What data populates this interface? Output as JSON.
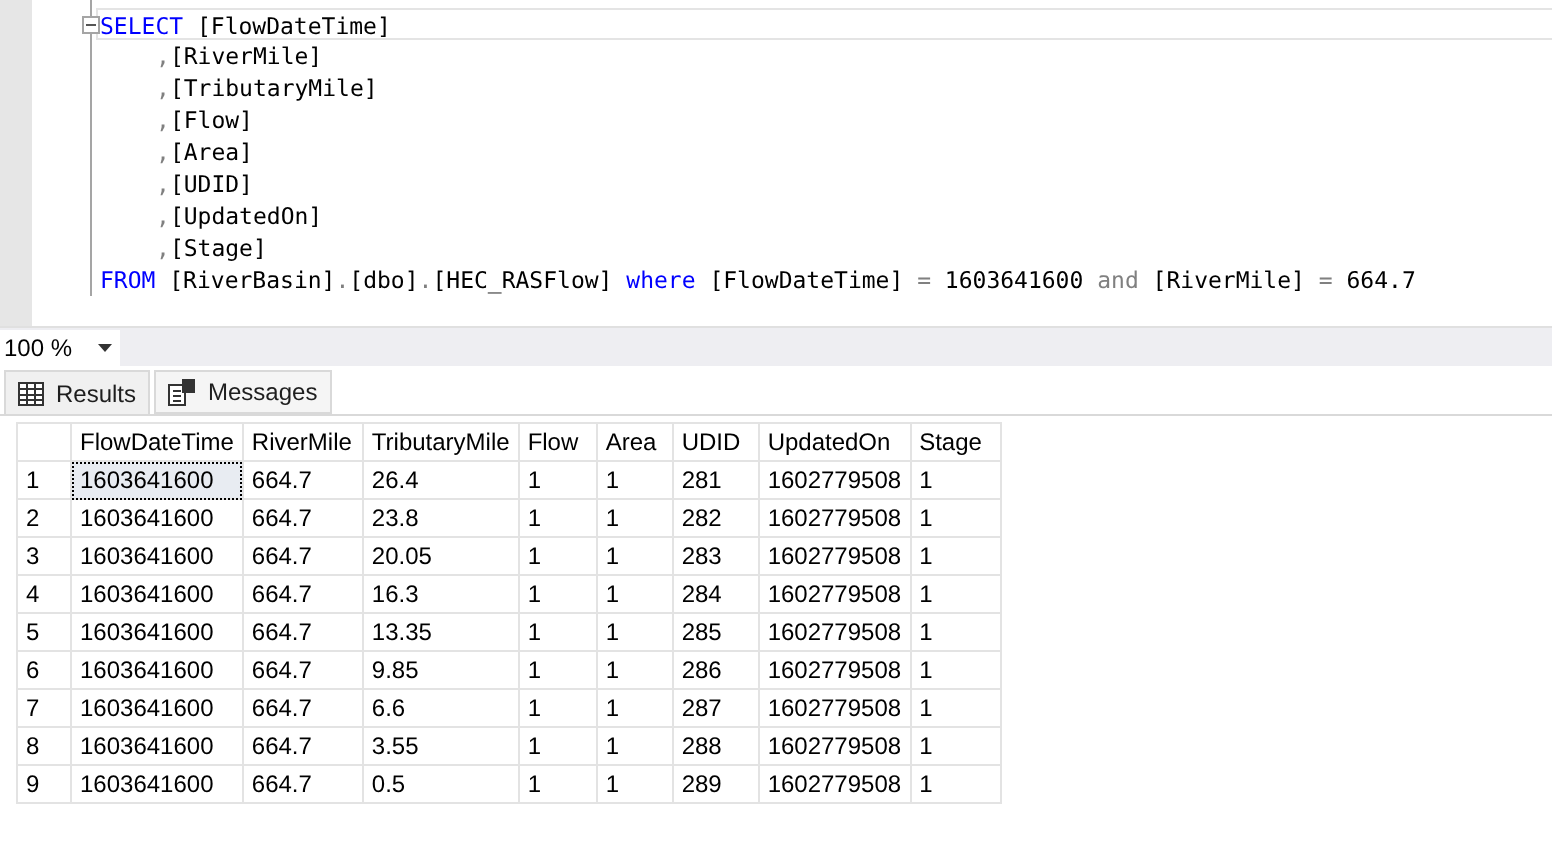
{
  "editor": {
    "lines": [
      {
        "tokens": [
          {
            "kind": "kw",
            "text": "SELECT"
          },
          {
            "kind": "ident",
            "text": " [FlowDateTime]"
          }
        ]
      },
      {
        "tokens": [
          {
            "kind": "op",
            "text": ","
          },
          {
            "kind": "ident",
            "text": "[RiverMile]"
          }
        ]
      },
      {
        "tokens": [
          {
            "kind": "op",
            "text": ","
          },
          {
            "kind": "ident",
            "text": "[TributaryMile]"
          }
        ]
      },
      {
        "tokens": [
          {
            "kind": "op",
            "text": ","
          },
          {
            "kind": "ident",
            "text": "[Flow]"
          }
        ]
      },
      {
        "tokens": [
          {
            "kind": "op",
            "text": ","
          },
          {
            "kind": "ident",
            "text": "[Area]"
          }
        ]
      },
      {
        "tokens": [
          {
            "kind": "op",
            "text": ","
          },
          {
            "kind": "ident",
            "text": "[UDID]"
          }
        ]
      },
      {
        "tokens": [
          {
            "kind": "op",
            "text": ","
          },
          {
            "kind": "ident",
            "text": "[UpdatedOn]"
          }
        ]
      },
      {
        "tokens": [
          {
            "kind": "op",
            "text": ","
          },
          {
            "kind": "ident",
            "text": "[Stage]"
          }
        ]
      },
      {
        "tokens": [
          {
            "kind": "kw",
            "text": "FROM"
          },
          {
            "kind": "ident",
            "text": " [RiverBasin]"
          },
          {
            "kind": "op",
            "text": "."
          },
          {
            "kind": "ident",
            "text": "[dbo]"
          },
          {
            "kind": "op",
            "text": "."
          },
          {
            "kind": "ident",
            "text": "[HEC_RASFlow] "
          },
          {
            "kind": "kw",
            "text": "where"
          },
          {
            "kind": "ident",
            "text": " [FlowDateTime] "
          },
          {
            "kind": "op",
            "text": "="
          },
          {
            "kind": "ident",
            "text": " 1603641600 "
          },
          {
            "kind": "op",
            "text": "and"
          },
          {
            "kind": "ident",
            "text": " [RiverMile] "
          },
          {
            "kind": "op",
            "text": "="
          },
          {
            "kind": "ident",
            "text": " 664.7"
          }
        ]
      }
    ]
  },
  "zoom": {
    "value": "100 %"
  },
  "tabs": [
    {
      "label": "Results",
      "kind": "grid",
      "selected": true
    },
    {
      "label": "Messages",
      "kind": "messages",
      "selected": false
    }
  ],
  "table": {
    "columns": [
      "FlowDateTime",
      "RiverMile",
      "TributaryMile",
      "Flow",
      "Area",
      "UDID",
      "UpdatedOn",
      "Stage"
    ],
    "rows": [
      {
        "number": "1",
        "cells": [
          {
            "text": "1603641600",
            "selected": true
          },
          {
            "text": "664.7",
            "selected": false
          },
          {
            "text": "26.4",
            "selected": false
          },
          {
            "text": "1",
            "selected": false
          },
          {
            "text": "1",
            "selected": false
          },
          {
            "text": "281",
            "selected": false
          },
          {
            "text": "1602779508",
            "selected": false
          },
          {
            "text": "1",
            "selected": false
          }
        ]
      },
      {
        "number": "2",
        "cells": [
          {
            "text": "1603641600",
            "selected": false
          },
          {
            "text": "664.7",
            "selected": false
          },
          {
            "text": "23.8",
            "selected": false
          },
          {
            "text": "1",
            "selected": false
          },
          {
            "text": "1",
            "selected": false
          },
          {
            "text": "282",
            "selected": false
          },
          {
            "text": "1602779508",
            "selected": false
          },
          {
            "text": "1",
            "selected": false
          }
        ]
      },
      {
        "number": "3",
        "cells": [
          {
            "text": "1603641600",
            "selected": false
          },
          {
            "text": "664.7",
            "selected": false
          },
          {
            "text": "20.05",
            "selected": false
          },
          {
            "text": "1",
            "selected": false
          },
          {
            "text": "1",
            "selected": false
          },
          {
            "text": "283",
            "selected": false
          },
          {
            "text": "1602779508",
            "selected": false
          },
          {
            "text": "1",
            "selected": false
          }
        ]
      },
      {
        "number": "4",
        "cells": [
          {
            "text": "1603641600",
            "selected": false
          },
          {
            "text": "664.7",
            "selected": false
          },
          {
            "text": "16.3",
            "selected": false
          },
          {
            "text": "1",
            "selected": false
          },
          {
            "text": "1",
            "selected": false
          },
          {
            "text": "284",
            "selected": false
          },
          {
            "text": "1602779508",
            "selected": false
          },
          {
            "text": "1",
            "selected": false
          }
        ]
      },
      {
        "number": "5",
        "cells": [
          {
            "text": "1603641600",
            "selected": false
          },
          {
            "text": "664.7",
            "selected": false
          },
          {
            "text": "13.35",
            "selected": false
          },
          {
            "text": "1",
            "selected": false
          },
          {
            "text": "1",
            "selected": false
          },
          {
            "text": "285",
            "selected": false
          },
          {
            "text": "1602779508",
            "selected": false
          },
          {
            "text": "1",
            "selected": false
          }
        ]
      },
      {
        "number": "6",
        "cells": [
          {
            "text": "1603641600",
            "selected": false
          },
          {
            "text": "664.7",
            "selected": false
          },
          {
            "text": "9.85",
            "selected": false
          },
          {
            "text": "1",
            "selected": false
          },
          {
            "text": "1",
            "selected": false
          },
          {
            "text": "286",
            "selected": false
          },
          {
            "text": "1602779508",
            "selected": false
          },
          {
            "text": "1",
            "selected": false
          }
        ]
      },
      {
        "number": "7",
        "cells": [
          {
            "text": "1603641600",
            "selected": false
          },
          {
            "text": "664.7",
            "selected": false
          },
          {
            "text": "6.6",
            "selected": false
          },
          {
            "text": "1",
            "selected": false
          },
          {
            "text": "1",
            "selected": false
          },
          {
            "text": "287",
            "selected": false
          },
          {
            "text": "1602779508",
            "selected": false
          },
          {
            "text": "1",
            "selected": false
          }
        ]
      },
      {
        "number": "8",
        "cells": [
          {
            "text": "1603641600",
            "selected": false
          },
          {
            "text": "664.7",
            "selected": false
          },
          {
            "text": "3.55",
            "selected": false
          },
          {
            "text": "1",
            "selected": false
          },
          {
            "text": "1",
            "selected": false
          },
          {
            "text": "288",
            "selected": false
          },
          {
            "text": "1602779508",
            "selected": false
          },
          {
            "text": "1",
            "selected": false
          }
        ]
      },
      {
        "number": "9",
        "cells": [
          {
            "text": "1603641600",
            "selected": false
          },
          {
            "text": "664.7",
            "selected": false
          },
          {
            "text": "0.5",
            "selected": false
          },
          {
            "text": "1",
            "selected": false
          },
          {
            "text": "1",
            "selected": false
          },
          {
            "text": "289",
            "selected": false
          },
          {
            "text": "1602779508",
            "selected": false
          },
          {
            "text": "1",
            "selected": false
          }
        ]
      }
    ]
  }
}
